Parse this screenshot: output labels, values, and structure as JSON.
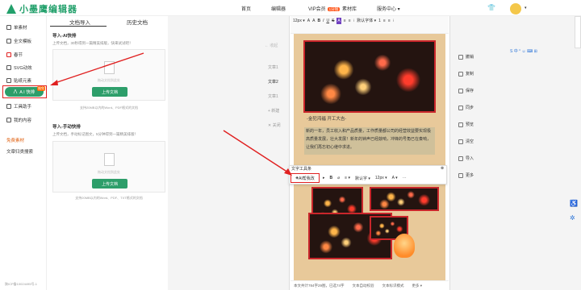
{
  "brand": {
    "name": "小墨鹰编辑器"
  },
  "nav": {
    "home": "首页",
    "editor": "编辑器",
    "vip": "VIP会员",
    "vip_badge": "1分钱",
    "materials": "素材库",
    "services": "服务中心 ▾"
  },
  "sidebar": {
    "items": [
      {
        "label": "单素材"
      },
      {
        "label": "全文模板"
      },
      {
        "label": "春节"
      },
      {
        "label": "SVG动效"
      },
      {
        "label": "贴纸元素"
      },
      {
        "label": "A I 快排"
      },
      {
        "label": "工具助手"
      },
      {
        "label": "我的内容"
      },
      {
        "label": "免费素材"
      },
      {
        "label": "文章归类搜索"
      }
    ],
    "ai_badge": "限免"
  },
  "panel": {
    "tabs": [
      {
        "label": "文档导入"
      },
      {
        "label": "历史文档"
      }
    ],
    "ai": {
      "title": "导入-AI快排",
      "desc": "上传文档，30秒得到一篇精美排版，快来试试吧！",
      "hint": "拖动文档到此处",
      "button": "上传文档",
      "note": "支持20MB以内的Word、PDF格式的文档"
    },
    "manual": {
      "title": "导入-手动快排",
      "desc": "上传文档，手动标记图文，5分钟得到一篇精美排版！",
      "hint": "拖动文档到此处",
      "button": "上传文档",
      "note": "支持20MB以内的Word、PDF、TXT格式的文档"
    }
  },
  "icp": "陕ICP备10024495号-1",
  "workspace": {
    "collapse": "← 收起",
    "docs": [
      "文章1",
      "文章2"
    ],
    "new": "+ 新建",
    "close": "✕ 关闭"
  },
  "editor": {
    "toolbar": [
      "12px ▾",
      "A",
      "A",
      "B",
      "I",
      "U",
      "S",
      "A",
      "≡",
      "≡",
      "⁝",
      "默认字体 ▾",
      "1",
      "≡",
      "≡",
      "⁝"
    ],
    "gold_title": "-金犯鸿福  开工大吉-",
    "paragraph": "新的一年，员工收入和产品质量，工作质量都公司的经营效益要实现极高质量发展，壮大发展！新年的钟声已经敲响，冲锋的号角已在奏响，让我们再忘初心继中求进。",
    "floating_title": "文字工具条",
    "ai_button": "AI帮我改",
    "floating_tools": [
      "▸",
      "B",
      "⌀",
      "≡ ▾",
      "默认字 ▾",
      "12px ▾",
      "A ▾",
      "⋯"
    ],
    "status": {
      "words": "本文共计784字29图，已选74字",
      "doc": "文本自动校验",
      "import": "文本标识模式",
      "more": "更多 ▾"
    }
  },
  "actions": [
    {
      "label": "撤销"
    },
    {
      "label": "复制"
    },
    {
      "label": "保存"
    },
    {
      "label": "同步"
    },
    {
      "label": "预览"
    },
    {
      "label": "清空"
    },
    {
      "label": "导入"
    },
    {
      "label": "更多"
    }
  ],
  "colors": {
    "green": "#2d9e6a",
    "red": "#e02020",
    "orange": "#ff5a1f"
  }
}
